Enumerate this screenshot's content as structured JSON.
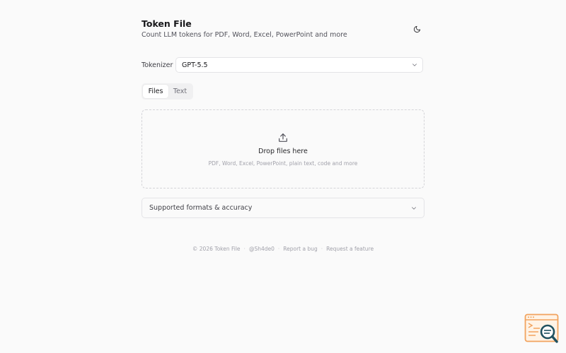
{
  "header": {
    "title": "Token File",
    "subtitle": "Count LLM tokens for PDF, Word, Excel, PowerPoint and more",
    "theme_icon": "moon-icon"
  },
  "tokenizer": {
    "label": "Tokenizer",
    "selected": "GPT-5.5"
  },
  "tabs": [
    {
      "label": "Files",
      "active": true
    },
    {
      "label": "Text",
      "active": false
    }
  ],
  "dropzone": {
    "icon": "upload-icon",
    "title": "Drop files here",
    "subtitle": "PDF, Word, Excel, PowerPoint, plain text, code and more"
  },
  "accordion": {
    "label": "Supported formats & accuracy"
  },
  "footer": {
    "copyright": "© 2026 Token File",
    "handle": "@Sh4de0",
    "report": "Report a bug",
    "request": "Request a feature"
  },
  "colors": {
    "background": "#fafafa",
    "text": "#18181b",
    "muted": "#a1a1aa",
    "border": "#e4e4e7",
    "badge_orange": "#f2a35e",
    "badge_teal": "#1f5160"
  }
}
